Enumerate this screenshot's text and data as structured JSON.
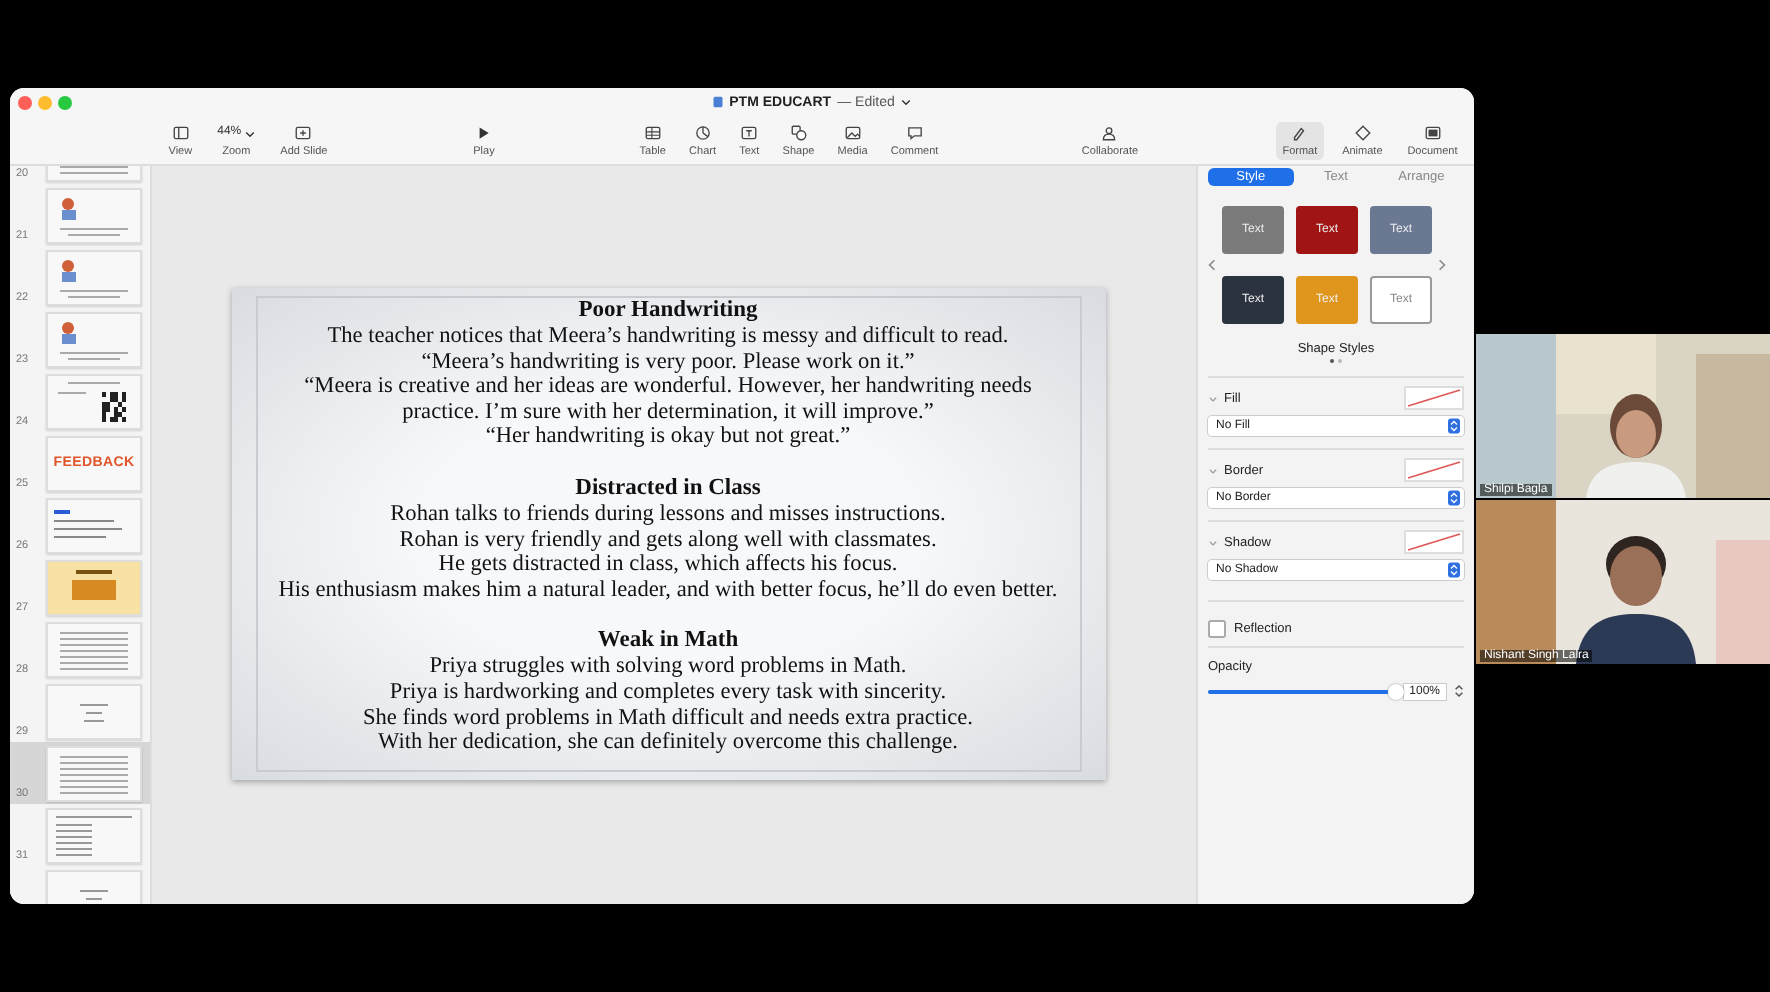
{
  "window": {
    "title": "PTM EDUCART",
    "status": "— Edited"
  },
  "toolbar": {
    "groups": [
      [
        {
          "label": "View"
        },
        {
          "label": "Zoom",
          "value": "44%"
        },
        {
          "label": "Add Slide"
        }
      ],
      [
        {
          "label": "Play"
        }
      ],
      [
        {
          "label": "Table"
        },
        {
          "label": "Chart"
        },
        {
          "label": "Text"
        },
        {
          "label": "Shape"
        },
        {
          "label": "Media"
        },
        {
          "label": "Comment"
        }
      ],
      [
        {
          "label": "Collaborate"
        }
      ],
      [
        {
          "label": "Format",
          "selected": true
        },
        {
          "label": "Animate",
          "selected": false
        },
        {
          "label": "Document",
          "selected": false
        }
      ]
    ]
  },
  "slide_navigator": [
    {
      "number": "20",
      "kind": "text",
      "selected": false
    },
    {
      "number": "21",
      "selected": false
    },
    {
      "number": "22",
      "selected": false
    },
    {
      "number": "23",
      "selected": false
    },
    {
      "number": "24",
      "kind": "qr",
      "selected": false
    },
    {
      "number": "25",
      "kind": "feedback",
      "title": "FEEDBACK",
      "selected": false
    },
    {
      "number": "26",
      "kind": "form",
      "selected": false
    },
    {
      "number": "27",
      "kind": "banner",
      "selected": false
    },
    {
      "number": "28",
      "kind": "text",
      "selected": false
    },
    {
      "number": "29",
      "kind": "sparse",
      "selected": false
    },
    {
      "number": "30",
      "kind": "text",
      "selected": true
    },
    {
      "number": "31",
      "kind": "list",
      "selected": false
    },
    {
      "kind": "sparse",
      "selected": false
    }
  ],
  "slide": {
    "sections": [
      {
        "heading": "Poor Handwriting",
        "lines": [
          "The teacher notices that Meera’s handwriting is messy and difficult to read.",
          "“Meera’s handwriting is very poor. Please work on it.”",
          "“Meera is creative and her ideas are wonderful. However, her handwriting needs",
          "practice. I’m sure with her determination, it will improve.”",
          "“Her handwriting is okay but not great.”"
        ]
      },
      {
        "heading": "Distracted in Class",
        "lines": [
          "Rohan talks to friends during lessons and misses instructions.",
          "Rohan is very friendly and gets along well with classmates.",
          "He gets distracted in class, which affects his focus.",
          "His enthusiasm makes him a natural leader, and with better focus, he’ll do even better."
        ]
      },
      {
        "heading": "Weak in Math",
        "lines": [
          "Priya struggles with solving word problems in Math.",
          "Priya is hardworking and completes every task with sincerity.",
          "She finds word problems in Math difficult and needs extra practice.",
          "With her dedication, she can definitely overcome this challenge."
        ]
      }
    ]
  },
  "inspector": {
    "tabs": [
      {
        "label": "Style",
        "selected": true
      },
      {
        "label": "Text",
        "selected": false
      },
      {
        "label": "Arrange",
        "selected": false
      }
    ],
    "shape_styles": [
      {
        "label": "Text",
        "color": "#7a7a7a"
      },
      {
        "label": "Text",
        "color": "#a01414"
      },
      {
        "label": "Text",
        "color": "#6a7892"
      },
      {
        "label": "Text",
        "color": "#2c3340"
      },
      {
        "label": "Text",
        "color": "#e0961c"
      },
      {
        "label": "Text",
        "color": "#ffffff"
      }
    ],
    "shape_styles_title": "Shape Styles",
    "sections": [
      {
        "label": "Fill",
        "value": "No Fill"
      },
      {
        "label": "Border",
        "value": "No Border"
      },
      {
        "label": "Shadow",
        "value": "No Shadow"
      }
    ],
    "reflection": {
      "label": "Reflection",
      "checked": false
    },
    "opacity": {
      "label": "Opacity",
      "level": 1,
      "reading": "100%"
    }
  },
  "participants": [
    {
      "name": "Shilpi Bagla",
      "kind": "picture"
    },
    {
      "name": "Nishant Singh Lalra",
      "kind": "picture"
    }
  ]
}
